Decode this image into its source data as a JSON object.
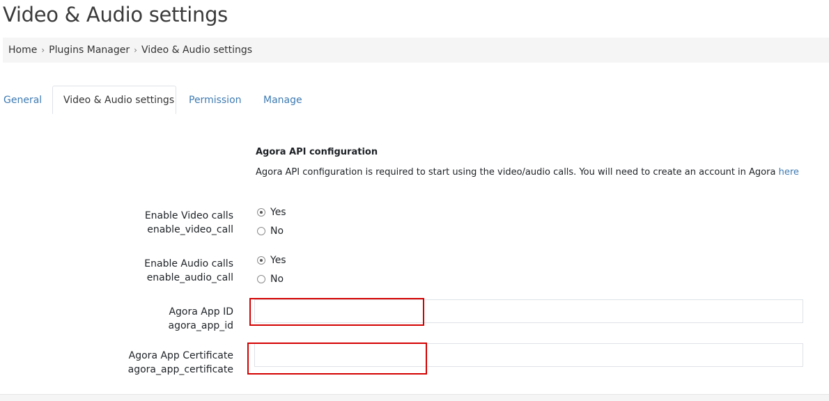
{
  "page": {
    "title": "Video & Audio settings"
  },
  "breadcrumb": {
    "items": [
      "Home",
      "Plugins Manager",
      "Video & Audio settings"
    ],
    "separator": "›"
  },
  "tabs": [
    {
      "label": "General",
      "active": false
    },
    {
      "label": "Video & Audio settings",
      "active": true
    },
    {
      "label": "Permission",
      "active": false
    },
    {
      "label": "Manage",
      "active": false
    }
  ],
  "section": {
    "heading": "Agora API configuration",
    "description": "Agora API configuration is required to start using the video/audio calls. You will need to create an account in Agora ",
    "link_text": "here"
  },
  "fields": {
    "enable_video_call": {
      "label": "Enable Video calls",
      "name": "enable_video_call",
      "options": [
        "Yes",
        "No"
      ],
      "selected": "Yes"
    },
    "enable_audio_call": {
      "label": "Enable Audio calls",
      "name": "enable_audio_call",
      "options": [
        "Yes",
        "No"
      ],
      "selected": "Yes"
    },
    "agora_app_id": {
      "label": "Agora App ID",
      "name": "agora_app_id",
      "value": ""
    },
    "agora_app_certificate": {
      "label": "Agora App Certificate",
      "name": "agora_app_certificate",
      "value": ""
    }
  },
  "colors": {
    "link": "#3d7ab2",
    "highlight": "#d40000",
    "breadcrumb_bg": "#f5f5f5"
  }
}
